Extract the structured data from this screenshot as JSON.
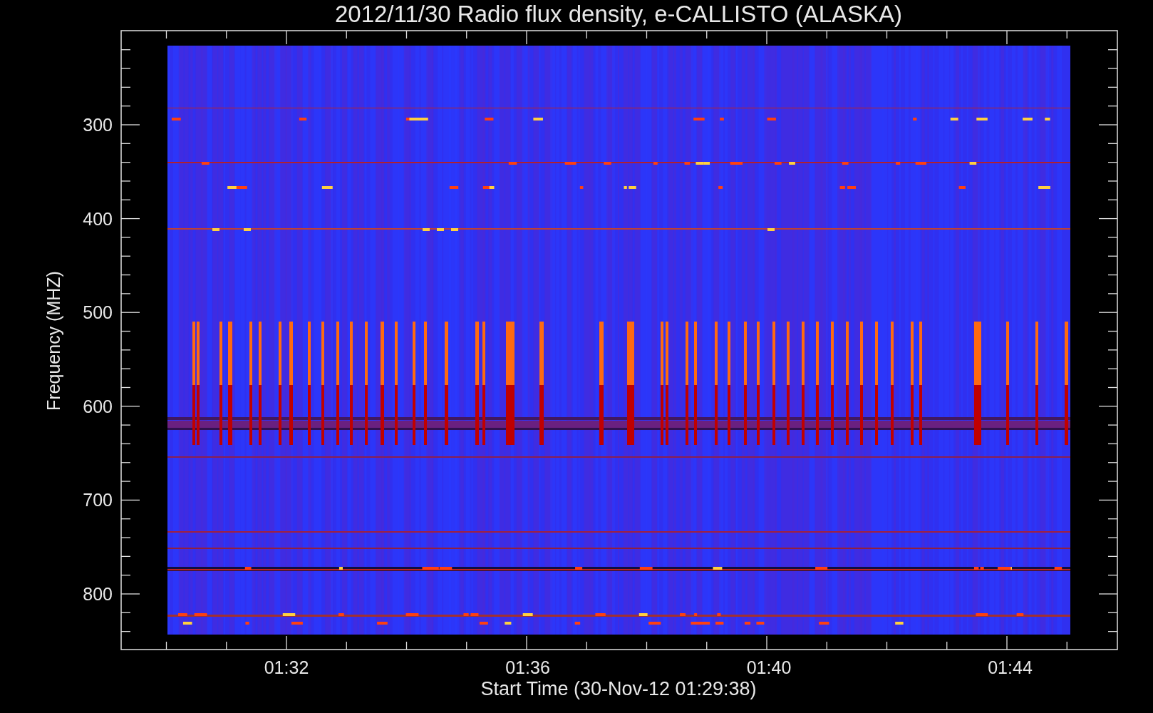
{
  "title": "2012/11/30  Radio flux density, e-CALLISTO (ALASKA)",
  "y_axis": {
    "label": "Frequency (MHZ)",
    "ticks": [
      "300",
      "400",
      "500",
      "600",
      "700",
      "800"
    ]
  },
  "x_axis": {
    "label": "Start Time (30-Nov-12 01:29:38)",
    "ticks": [
      "01:32",
      "01:36",
      "01:40",
      "01:44"
    ]
  }
}
